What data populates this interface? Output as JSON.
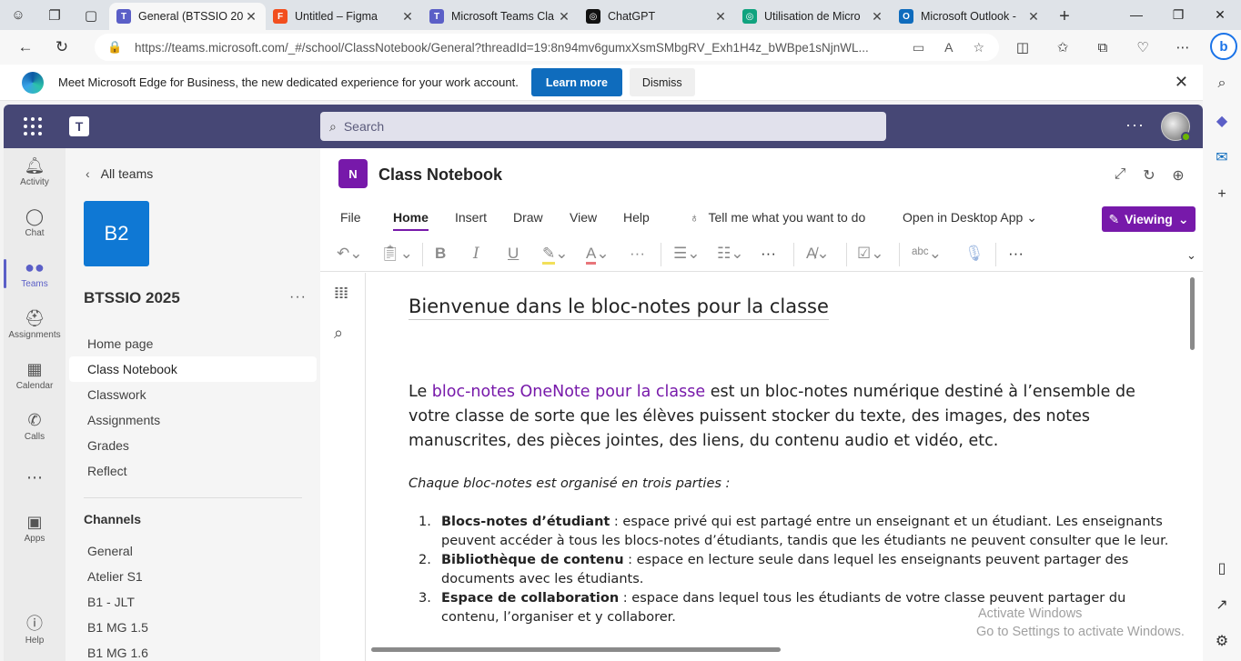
{
  "browser": {
    "tabs": [
      {
        "title": "General (BTSSIO 202",
        "color": "#5b5fc7",
        "icon": "teams-icon"
      },
      {
        "title": "Untitled – Figma",
        "color": "#f24e1e",
        "icon": "figma-icon"
      },
      {
        "title": "Microsoft Teams Cla",
        "color": "#5b5fc7",
        "icon": "teams-icon"
      },
      {
        "title": "ChatGPT",
        "color": "#111111",
        "icon": "chatgpt-icon"
      },
      {
        "title": "Utilisation de Micro",
        "color": "#10a37f",
        "icon": "chatgpt-icon"
      },
      {
        "title": "Microsoft Outlook -",
        "color": "#0f6cbd",
        "icon": "outlook-icon"
      }
    ],
    "url": "https://teams.microsoft.com/_#/school/ClassNotebook/General?threadId=19:8n94mv6gumxXsmSMbgRV_Exh1H4z_bWBpe1sNjnWL..."
  },
  "banner": {
    "message": "Meet Microsoft Edge for Business, the new dedicated experience for your work account.",
    "learn_more": "Learn more",
    "dismiss": "Dismiss"
  },
  "teams": {
    "search_placeholder": "Search",
    "rail": [
      {
        "label": "Activity",
        "icon": "🔔"
      },
      {
        "label": "Chat",
        "icon": "💬"
      },
      {
        "label": "Teams",
        "icon": "👥"
      },
      {
        "label": "Assignments",
        "icon": "🎒"
      },
      {
        "label": "Calendar",
        "icon": "📅"
      },
      {
        "label": "Calls",
        "icon": "📞"
      },
      {
        "label": "",
        "icon": "⋯"
      },
      {
        "label": "Apps",
        "icon": "▦"
      },
      {
        "label": "Help",
        "icon": "?"
      }
    ],
    "back_label": "All teams",
    "team_initials": "B2",
    "team_name": "BTSSIO 2025",
    "nav": [
      "Home page",
      "Class Notebook",
      "Classwork",
      "Assignments",
      "Grades",
      "Reflect"
    ],
    "channels_header": "Channels",
    "channels": [
      "General",
      "Atelier S1",
      "B1 - JLT",
      "B1 MG 1.5",
      "B1 MG 1.6"
    ]
  },
  "notebook": {
    "icon_text": "N",
    "title": "Class Notebook",
    "ribbon_tabs": [
      "File",
      "Home",
      "Insert",
      "Draw",
      "View",
      "Help"
    ],
    "tell_me": "Tell me what you want to do",
    "open_desktop": "Open in Desktop App",
    "viewing": "Viewing",
    "page_title": "Bienvenue dans le bloc-notes pour la classe",
    "intro_before": "Le ",
    "intro_link": "bloc-notes OneNote pour la classe",
    "intro_after": " est un bloc-notes numérique destiné à l’ensemble de votre classe de sorte que les élèves puissent stocker du texte, des images, des notes manuscrites, des pièces jointes, des liens, du contenu audio et vidéo, etc.",
    "subtitle": "Chaque bloc-notes est organisé en trois parties :",
    "items": [
      {
        "num": "1.",
        "term": "Blocs-notes d’étudiant",
        "text": " : espace privé qui est partagé entre un enseignant et un étudiant. Les enseignants peuvent accéder à tous les blocs-notes d’étudiants, tandis que les étudiants ne peuvent consulter que le leur."
      },
      {
        "num": "2.",
        "term": "Bibliothèque de contenu",
        "text": " : espace en lecture seule dans lequel les enseignants peuvent partager des documents avec les étudiants."
      },
      {
        "num": "3.",
        "term": "Espace de collaboration",
        "text": " : espace dans lequel tous les étudiants de votre classe peuvent partager du contenu, l’organiser et y collaborer."
      }
    ]
  },
  "watermark": {
    "line1": "Activate Windows",
    "line2": "Go to Settings to activate Windows."
  }
}
